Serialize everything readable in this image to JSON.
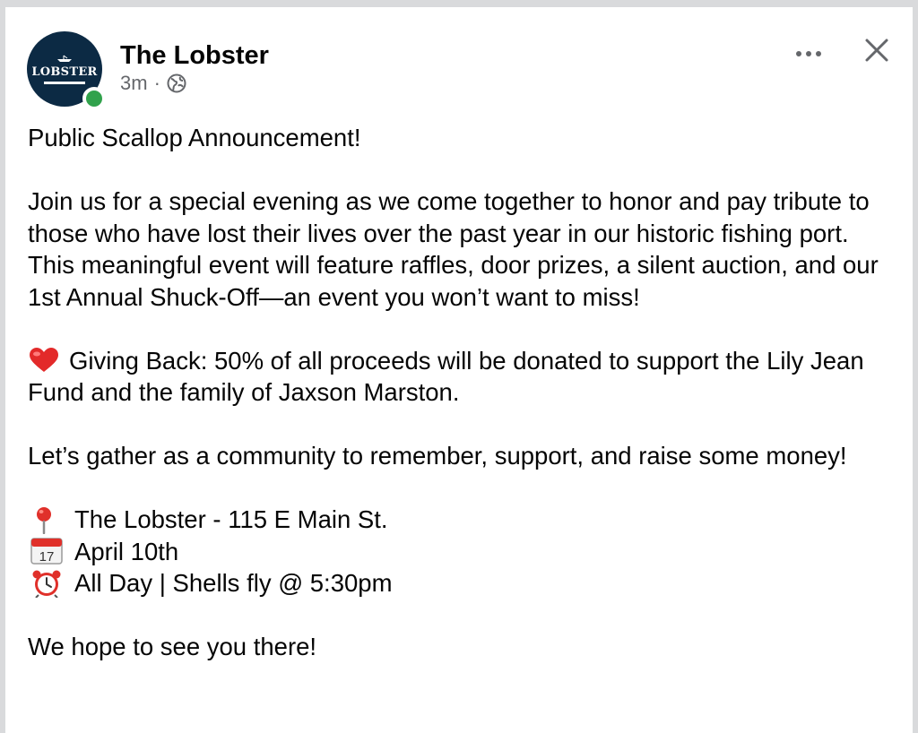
{
  "post": {
    "author": "The Lobster",
    "avatar_text": "LOBSTER",
    "timestamp": "3m",
    "separator": "·",
    "privacy_icon": "globe-icon",
    "more_icon": "more-dots-icon",
    "close_icon": "close-icon",
    "online_status_color": "#31a24c",
    "paragraphs": {
      "p1": "Public Scallop Announcement!",
      "p2a": "Join us for a special evening as we come together to honor and pay tribute to those who have lost their lives over the past year in our historic fishing port.",
      "p2b": "This meaningful event will feature raffles, door prizes, a silent auction, and our 1st Annual Shuck-Off—an event you won’t want to miss!",
      "p3": "Giving Back: 50% of all proceeds will be donated to support the Lily Jean Fund and the family of Jaxson Marston.",
      "p4": "Let’s gather as a community to remember, support, and raise some money!",
      "location": "The Lobster - 115 E Main St.",
      "date": "April 10th",
      "time": "All Day | Shells fly @ 5:30pm",
      "closing": "We hope to see you there!"
    },
    "emoji": {
      "heart": "heart-emoji",
      "pin": "pin-emoji",
      "calendar": "calendar-emoji",
      "alarm": "alarm-clock-emoji"
    }
  }
}
